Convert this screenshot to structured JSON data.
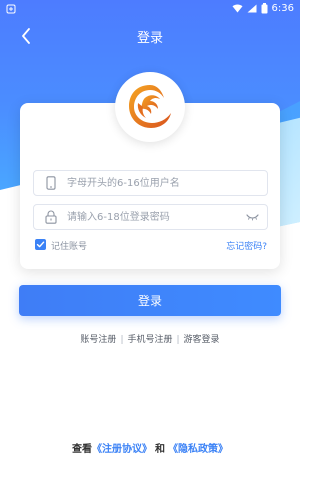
{
  "status_bar": {
    "time": "6:36"
  },
  "app_bar": {
    "title": "登录",
    "back_icon": "chevron-left-icon"
  },
  "form": {
    "username_placeholder": "字母开头的6-16位用户名",
    "password_placeholder": "请输入6-18位登录密码",
    "remember_label": "记住账号",
    "forgot_label": "忘记密码?",
    "remember_checked": true
  },
  "actions": {
    "login_label": "登录"
  },
  "links": {
    "account_register": "账号注册",
    "phone_register": "手机号注册",
    "guest_login": "游客登录",
    "separator": "|"
  },
  "agreement": {
    "prefix": "查看",
    "register_agreement": "《注册协议》",
    "and": "和",
    "privacy_policy": "《隐私政策》"
  },
  "colors": {
    "header_blue": "#4b8dff",
    "accent_blue": "#3b82f6",
    "logo_orange": "#e46f1f"
  }
}
